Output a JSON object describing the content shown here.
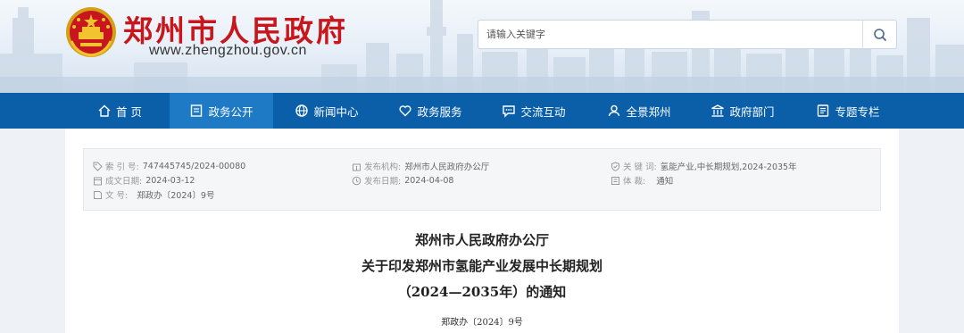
{
  "header": {
    "site_title": "郑州市人民政府",
    "site_url": "www.zhengzhou.gov.cn",
    "search_placeholder": "请输入关键字"
  },
  "nav": [
    {
      "label": "首 页",
      "icon": "home-icon"
    },
    {
      "label": "政务公开",
      "icon": "document-icon",
      "active": true
    },
    {
      "label": "新闻中心",
      "icon": "globe-icon"
    },
    {
      "label": "政务服务",
      "icon": "heart-icon"
    },
    {
      "label": "交流互动",
      "icon": "chat-icon"
    },
    {
      "label": "全景郑州",
      "icon": "users-icon"
    },
    {
      "label": "政府部门",
      "icon": "building-icon"
    },
    {
      "label": "专题专栏",
      "icon": "list-icon"
    }
  ],
  "meta": {
    "index_label": "索 引 号:",
    "index_value": "747445745/2024-00080",
    "publisher_label": "发布机构:",
    "publisher_value": "郑州市人民政府办公厅",
    "keywords_label": "关 键 词:",
    "keywords_value": "氢能产业,中长期规划,2024-2035年",
    "created_label": "成文日期:",
    "created_value": "2024-03-12",
    "published_label": "发布日期:",
    "published_value": "2024-04-08",
    "genre_label": "体 裁:",
    "genre_value": "通知",
    "docno_label": "文 号:",
    "docno_value": "郑政办〔2024〕9号"
  },
  "document": {
    "title_line1": "郑州市人民政府办公厅",
    "title_line2": "关于印发郑州市氢能产业发展中长期规划",
    "title_line3": "（2024—2035年）的通知",
    "doc_number": "郑政办〔2024〕9号"
  },
  "colors": {
    "title_red": "#c8161d",
    "nav_blue": "#0a5fa8",
    "nav_active": "#1e7ac4"
  }
}
